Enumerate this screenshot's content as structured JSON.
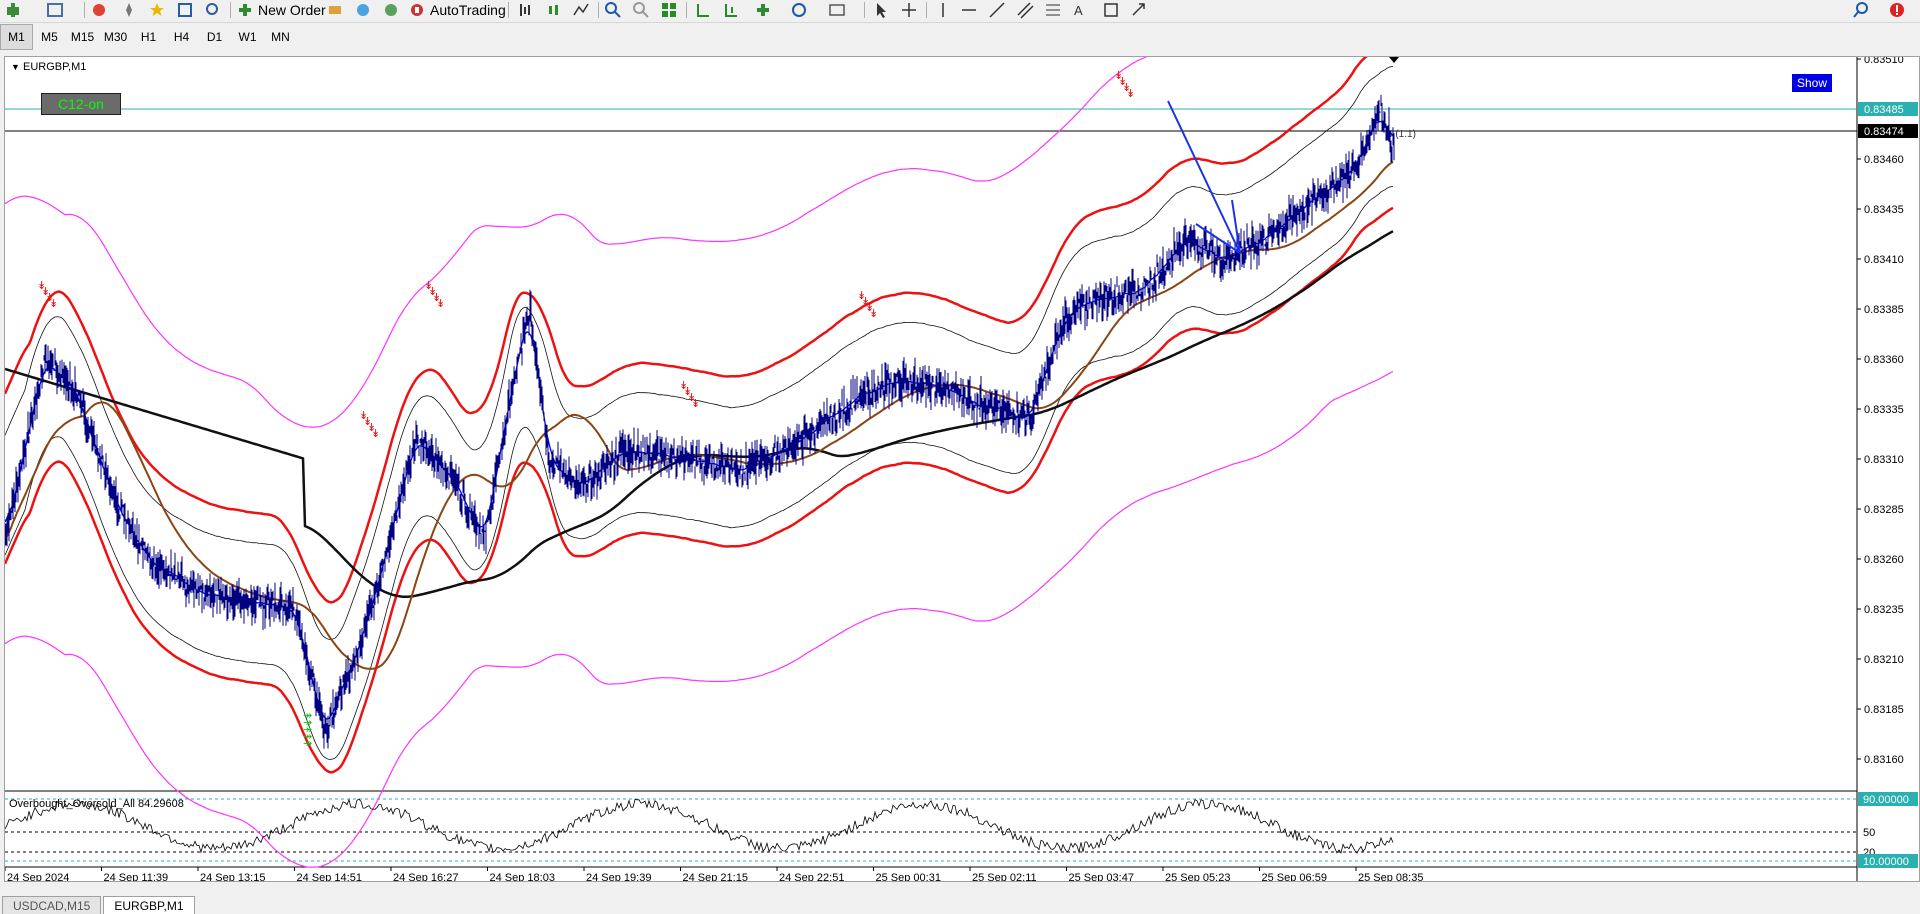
{
  "toolbar": {
    "new_order": "New Order",
    "autotrading": "AutoTrading"
  },
  "timeframes": [
    "M1",
    "M5",
    "M15",
    "M30",
    "H1",
    "H4",
    "D1",
    "W1",
    "MN"
  ],
  "active_timeframe": "M1",
  "chart": {
    "symbol": "EURGBP,M1",
    "indicator_label": "C12-on",
    "show_button": "Show",
    "sub_label": "Overbought_Oversold_All 84.29608",
    "trade_level_label": "4 (1.1)",
    "price_labels": [
      "0.83510",
      "0.83460",
      "0.83435",
      "0.83410",
      "0.83385",
      "0.83360",
      "0.83335",
      "0.83310",
      "0.83285",
      "0.83260",
      "0.83235",
      "0.83210",
      "0.83185",
      "0.83160"
    ],
    "current_price": "0.83474",
    "line_price": "0.83485",
    "sub_levels": [
      "90.00000",
      "50",
      "20",
      "10.00000"
    ],
    "time_labels": [
      "24 Sep 2024",
      "24 Sep 11:39",
      "24 Sep 13:15",
      "24 Sep 14:51",
      "24 Sep 16:27",
      "24 Sep 18:03",
      "24 Sep 19:39",
      "24 Sep 21:15",
      "24 Sep 22:51",
      "25 Sep 00:31",
      "25 Sep 02:11",
      "25 Sep 03:47",
      "25 Sep 05:23",
      "25 Sep 06:59",
      "25 Sep 08:35"
    ]
  },
  "tabs": [
    {
      "label": "USDCAD,M15",
      "active": false
    },
    {
      "label": "EURGBP,M1",
      "active": true
    }
  ],
  "colors": {
    "upper_lower_band": "#ff33ff",
    "envelope": "#ee1111",
    "ma_blue": "#0000ff",
    "ma_brown": "#8b4513",
    "ma_long": "#111111",
    "arrow": "#1a33e6",
    "price_bars": "#000080"
  }
}
